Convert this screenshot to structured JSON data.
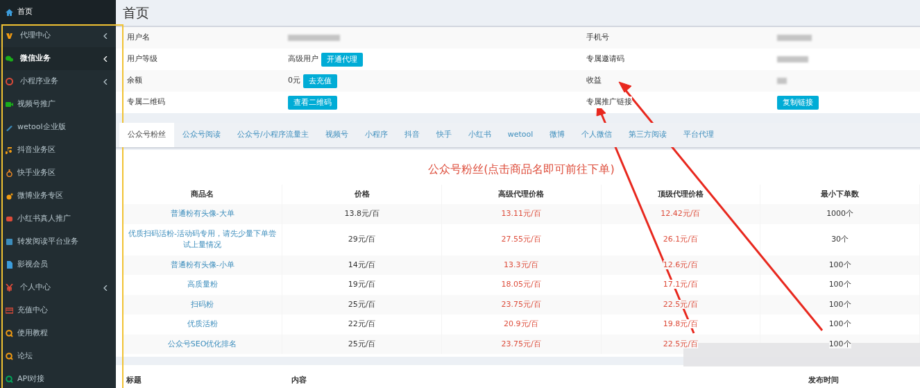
{
  "sidebar": {
    "home": {
      "label": "首页",
      "color": "#3c9ddc"
    },
    "items": [
      {
        "label": "代理中心",
        "color": "#f39c12",
        "expandable": true,
        "selected": false
      },
      {
        "label": "微信业务",
        "color": "#1aad19",
        "expandable": true,
        "selected": true
      },
      {
        "label": "小程序业务",
        "color": "#dd4b39",
        "expandable": true,
        "selected": false
      },
      {
        "label": "视频号推广",
        "color": "#1aad19",
        "expandable": false,
        "selected": false
      },
      {
        "label": "wetool企业版",
        "color": "#3c8dbc",
        "expandable": false,
        "selected": false
      },
      {
        "label": "抖音业务区",
        "color": "#f39c12",
        "expandable": false,
        "selected": false
      },
      {
        "label": "快手业务区",
        "color": "#f08a24",
        "expandable": false,
        "selected": false
      },
      {
        "label": "微博业务专区",
        "color": "#f39c12",
        "expandable": false,
        "selected": false
      },
      {
        "label": "小红书真人推广",
        "color": "#dd4b39",
        "expandable": false,
        "selected": false
      },
      {
        "label": "转发阅读平台业务",
        "color": "#3c8dbc",
        "expandable": false,
        "selected": false
      },
      {
        "label": "影视会员",
        "color": "#3c9ddc",
        "expandable": false,
        "selected": false
      },
      {
        "label": "个人中心",
        "color": "#dd4b39",
        "expandable": true,
        "selected": false
      },
      {
        "label": "充值中心",
        "color": "#dd4b39",
        "expandable": false,
        "selected": false
      },
      {
        "label": "使用教程",
        "color": "#f39c12",
        "expandable": false,
        "selected": false
      },
      {
        "label": "论坛",
        "color": "#f39c12",
        "expandable": false,
        "selected": false
      },
      {
        "label": "API对接",
        "color": "#00a65a",
        "expandable": false,
        "selected": false
      }
    ]
  },
  "page_title": "首页",
  "user_info": {
    "rows": [
      {
        "left": {
          "label": "用户名"
        },
        "right": {
          "label": "手机号"
        }
      },
      {
        "left": {
          "label": "用户等级",
          "value": "高级用户",
          "button": "开通代理"
        },
        "right": {
          "label": "专属邀请码"
        }
      },
      {
        "left": {
          "label": "余额",
          "value": "0元",
          "button": "去充值"
        },
        "right": {
          "label": "收益"
        }
      },
      {
        "left": {
          "label": "专属二维码",
          "button": "查看二维码"
        },
        "right": {
          "label": "专属推广链接",
          "button": "复制链接"
        }
      }
    ]
  },
  "tabs": [
    {
      "label": "公众号粉丝",
      "selected": true
    },
    {
      "label": "公众号阅读",
      "selected": false
    },
    {
      "label": "公众号/小程序流量主",
      "selected": false
    },
    {
      "label": "视频号",
      "selected": false
    },
    {
      "label": "小程序",
      "selected": false
    },
    {
      "label": "抖音",
      "selected": false
    },
    {
      "label": "快手",
      "selected": false
    },
    {
      "label": "小红书",
      "selected": false
    },
    {
      "label": "wetool",
      "selected": false
    },
    {
      "label": "微博",
      "selected": false
    },
    {
      "label": "个人微信",
      "selected": false
    },
    {
      "label": "第三方阅读",
      "selected": false
    },
    {
      "label": "平台代理",
      "selected": false
    }
  ],
  "products": {
    "title": "公众号粉丝(点击商品名即可前往下单)",
    "columns": [
      "商品名",
      "价格",
      "高级代理价格",
      "顶级代理价格",
      "最小下单数"
    ],
    "rows": [
      [
        "普通粉有头像-大单",
        "13.8元/百",
        "13.11元/百",
        "12.42元/百",
        "1000个"
      ],
      [
        "优质扫码活粉-活动码专用，请先少量下单尝试上量情况",
        "29元/百",
        "27.55元/百",
        "26.1元/百",
        "30个"
      ],
      [
        "普通粉有头像-小单",
        "14元/百",
        "13.3元/百",
        "12.6元/百",
        "100个"
      ],
      [
        "高质量粉",
        "19元/百",
        "18.05元/百",
        "17.1元/百",
        "100个"
      ],
      [
        "扫码粉",
        "25元/百",
        "23.75元/百",
        "22.5元/百",
        "100个"
      ],
      [
        "优质活粉",
        "22元/百",
        "20.9元/百",
        "19.8元/百",
        "100个"
      ],
      [
        "公众号SEO优化排名",
        "25元/百",
        "23.75元/百",
        "22.5元/百",
        "100个"
      ]
    ]
  },
  "notices": {
    "columns": [
      "标题",
      "内容",
      "发布时间"
    ]
  }
}
